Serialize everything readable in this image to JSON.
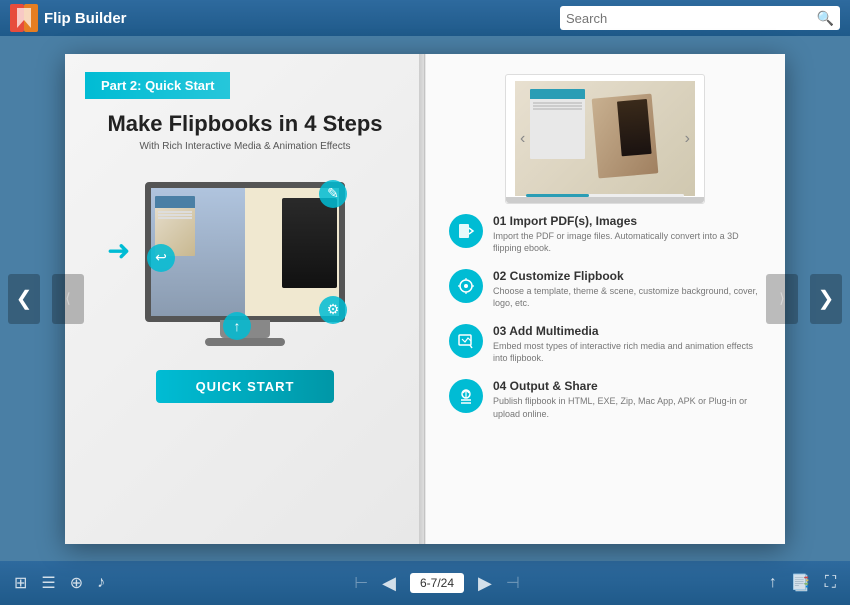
{
  "app": {
    "name": "Flip Builder"
  },
  "search": {
    "placeholder": "Search"
  },
  "book": {
    "left_page": {
      "part_badge": "Part 2: Quick Start",
      "main_title": "Make Flipbooks in 4 Steps",
      "subtitle": "With Rich Interactive Media & Animation Effects",
      "quick_start_button": "QUICK START"
    },
    "right_page": {
      "steps": [
        {
          "number": "01",
          "title": "01 Import PDF(s), Images",
          "desc": "Import the PDF or image files. Automatically convert into a 3D flipping ebook."
        },
        {
          "number": "02",
          "title": "02 Customize Flipbook",
          "desc": "Choose a template, theme & scene, customize background, cover, logo, etc."
        },
        {
          "number": "03",
          "title": "03 Add Multimedia",
          "desc": "Embed most types of interactive rich media and animation effects into flipbook."
        },
        {
          "number": "04",
          "title": "04 Output & Share",
          "desc": "Publish flipbook in HTML, EXE, Zip, Mac App, APK or Plug-in or upload online."
        }
      ]
    }
  },
  "pagination": {
    "current": "6-7/24"
  },
  "nav": {
    "prev_arrow": "❮",
    "next_arrow": "❯",
    "left_page_end": "⟨",
    "right_page_end": "⟩"
  },
  "bottom_toolbar": {
    "grid_icon": "⊞",
    "list_icon": "☰",
    "zoom_icon": "⊕",
    "audio_icon": "♪",
    "first_icon": "⊢",
    "prev_icon": "◀",
    "next_icon": "▶",
    "last_icon": "⊣",
    "share_icon": "↑",
    "fullscreen_icon": "⛶",
    "expand_icon": "⤡"
  }
}
